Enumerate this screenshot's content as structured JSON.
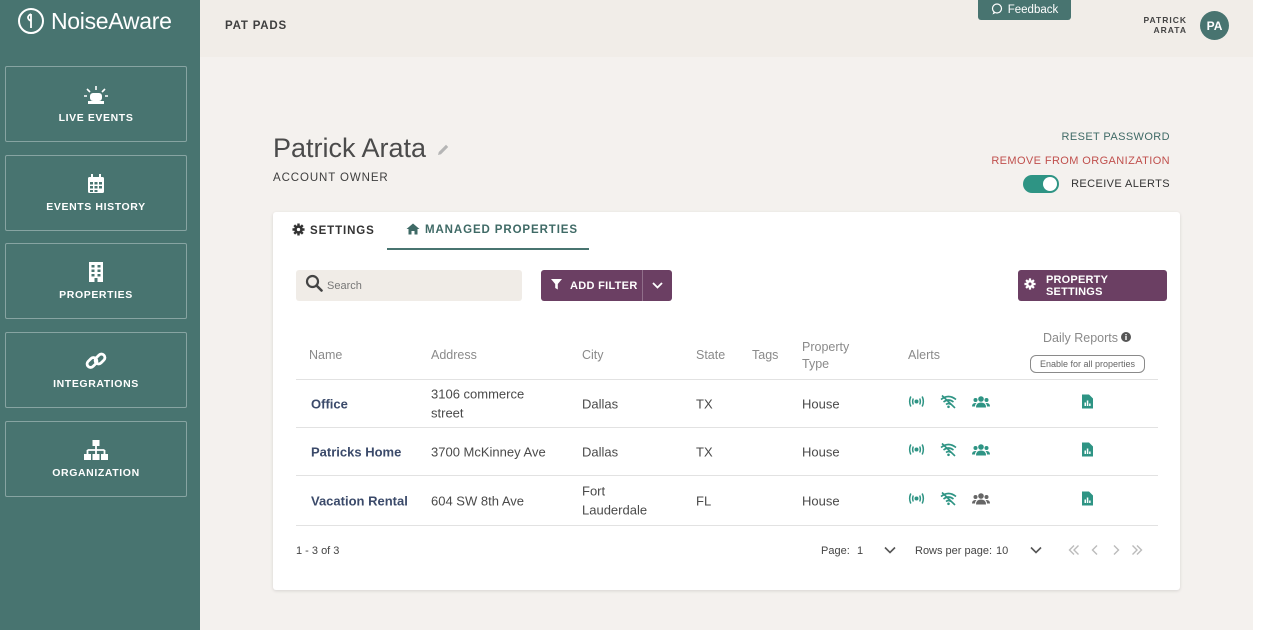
{
  "app": {
    "name": "NoiseAware"
  },
  "sidebar": {
    "items": [
      {
        "label": "LIVE EVENTS",
        "icon": "siren-icon"
      },
      {
        "label": "EVENTS HISTORY",
        "icon": "calendar-icon"
      },
      {
        "label": "PROPERTIES",
        "icon": "building-icon"
      },
      {
        "label": "INTEGRATIONS",
        "icon": "link-icon"
      },
      {
        "label": "ORGANIZATION",
        "icon": "org-chart-icon"
      }
    ]
  },
  "topbar": {
    "org_name": "PAT PADS",
    "feedback_label": "Feedback",
    "user_first": "PATRICK",
    "user_last": "ARATA",
    "avatar_initials": "PA"
  },
  "profile": {
    "name": "Patrick Arata",
    "role": "ACCOUNT OWNER",
    "reset_password": "RESET PASSWORD",
    "remove_from_org": "REMOVE FROM ORGANIZATION",
    "receive_alerts": "RECEIVE ALERTS",
    "receive_alerts_on": true
  },
  "tabs": {
    "settings": "SETTINGS",
    "managed_properties": "MANAGED PROPERTIES"
  },
  "toolbar": {
    "search_placeholder": "Search",
    "add_filter": "ADD FILTER",
    "property_settings": "PROPERTY SETTINGS"
  },
  "table": {
    "headers": {
      "name": "Name",
      "address": "Address",
      "city": "City",
      "state": "State",
      "tags": "Tags",
      "property_type_1": "Property",
      "property_type_2": "Type",
      "alerts": "Alerts",
      "daily_reports": "Daily Reports",
      "enable_all": "Enable for all properties"
    },
    "rows": [
      {
        "name": "Office",
        "address_1": "3106 commerce",
        "address_2": "street",
        "city_1": "Dallas",
        "city_2": "",
        "state": "TX",
        "tags": "",
        "type": "House"
      },
      {
        "name": "Patricks Home",
        "address_1": "3700 McKinney Ave",
        "address_2": "",
        "city_1": "Dallas",
        "city_2": "",
        "state": "TX",
        "tags": "",
        "type": "House"
      },
      {
        "name": "Vacation Rental",
        "address_1": "604 SW 8th Ave",
        "address_2": "",
        "city_1": "Fort",
        "city_2": "Lauderdale",
        "state": "FL",
        "tags": "",
        "type": "House"
      }
    ]
  },
  "pagination": {
    "count": "1 - 3 of 3",
    "page_label": "Page:",
    "page_value": "1",
    "rows_label": "Rows per page:",
    "rows_value": "10"
  },
  "colors": {
    "sidebar": "#487470",
    "accent_purple": "#6b3f63",
    "teal_icon": "#2e9484",
    "danger": "#c0504d"
  }
}
